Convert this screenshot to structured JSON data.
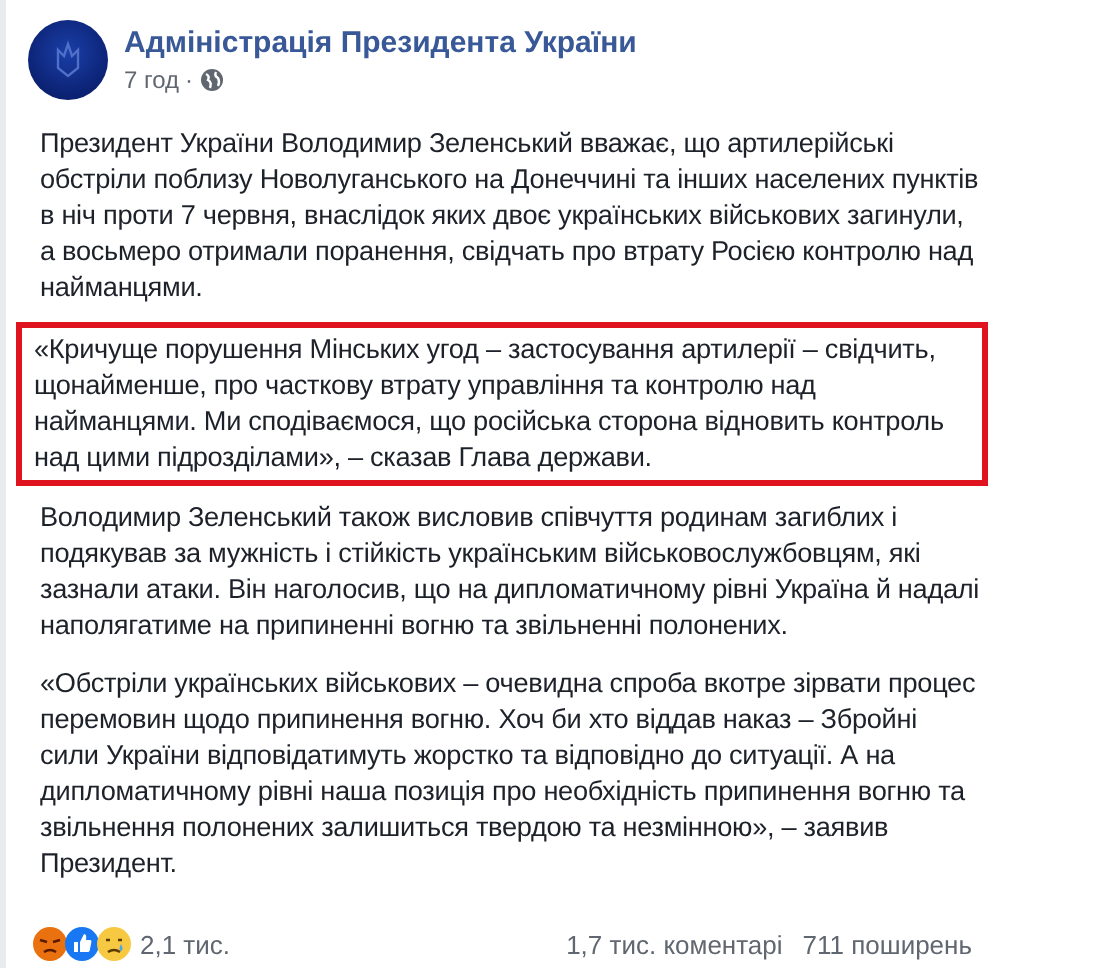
{
  "post": {
    "author": "Адміністрація Президента України",
    "time": "7 год",
    "separator": "·"
  },
  "paragraphs": [
    {
      "text": "Президент України Володимир Зеленський вважає, що артилерійські обстріли поблизу Новолуганського на Донеччині та інших населених пунктів в ніч проти 7 червня, внаслідок яких двоє українських військових загинули, а восьмеро отримали поранення, свідчать про втрату Росією контролю над найманцями.",
      "highlighted": false
    },
    {
      "text": "«Кричуще порушення Мінських угод – застосування артилерії – свідчить, щонайменше, про часткову втрату управління та контролю над найманцями. Ми сподіваємося, що російська сторона відновить контроль над цими підрозділами», – сказав Глава держави.",
      "highlighted": true
    },
    {
      "text": "Володимир Зеленський також висловив співчуття родинам загиблих і подякував за мужність і стійкість українським військовослужбовцям, які зазнали атаки. Він наголосив, що на дипломатичному рівні Україна й надалі наполягатиме на припиненні вогню та звільненні полонених.",
      "highlighted": false
    },
    {
      "text": "«Обстріли українських військових – очевидна спроба вкотре зірвати процес перемовин щодо припинення вогню. Хоч би хто віддав наказ – Збройні сили України відповідатимуть жорстко та відповідно до ситуації. А на дипломатичному рівні наша позиція про необхідність припинення вогню та звільнення полонених залишиться твердою та незмінною», – заявив Президент.",
      "highlighted": false
    }
  ],
  "footer": {
    "reactions": "2,1 тис.",
    "comments": "1,7 тис. коментарі",
    "shares": "711 поширень"
  }
}
